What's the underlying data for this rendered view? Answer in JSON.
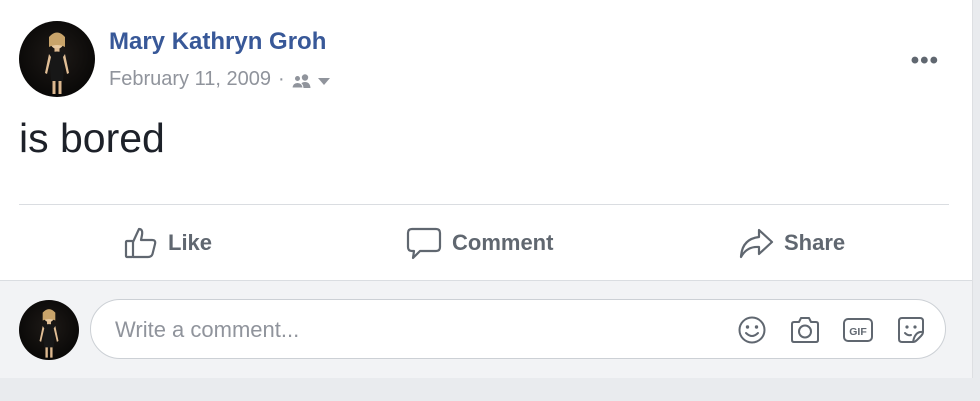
{
  "post": {
    "author": "Mary Kathryn Groh",
    "date": "February 11, 2009",
    "separator": "·",
    "audience_icon": "friends-icon",
    "more_label": "•••",
    "status_text": "is bored"
  },
  "actions": [
    {
      "label": "Like",
      "icon": "thumbs-up-icon"
    },
    {
      "label": "Comment",
      "icon": "comment-bubble-icon"
    },
    {
      "label": "Share",
      "icon": "share-arrow-icon"
    }
  ],
  "comment": {
    "placeholder": "Write a comment...",
    "icons": [
      "emoji-icon",
      "camera-icon",
      "gif-icon",
      "sticker-icon"
    ]
  },
  "colors": {
    "author_link": "#385898",
    "meta_gray": "#90949c",
    "action_gray": "#606770",
    "page_bg": "#e9ebee"
  }
}
